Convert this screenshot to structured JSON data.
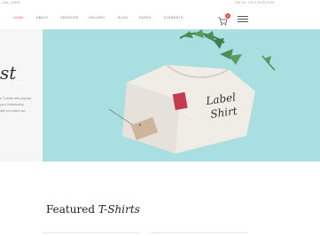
{
  "topbar": {
    "left_text": "USA, 10001",
    "right_text": "Call Us: +61 3 8376 6284"
  },
  "nav": {
    "items": [
      {
        "label": "HOME",
        "active": true
      },
      {
        "label": "ABOUT"
      },
      {
        "label": "SERVICES"
      },
      {
        "label": "GALLERY"
      },
      {
        "label": "BLOG"
      },
      {
        "label": "PAGES"
      },
      {
        "label": "ELEMENTS"
      }
    ],
    "cart_count": "0",
    "cart_icon": "cart-icon",
    "menu_icon": "menu-icon",
    "accent_color": "#e0524f"
  },
  "hero": {
    "title_partial": "st",
    "subtitle_lines": "e T-shirts with popular\nyour individuality,\nake you stand out.",
    "background_color": "#a9dfe0",
    "shirt_text": "Label Shirt"
  },
  "featured": {
    "title_main": "Featured",
    "title_accent": "T-Shirts"
  }
}
